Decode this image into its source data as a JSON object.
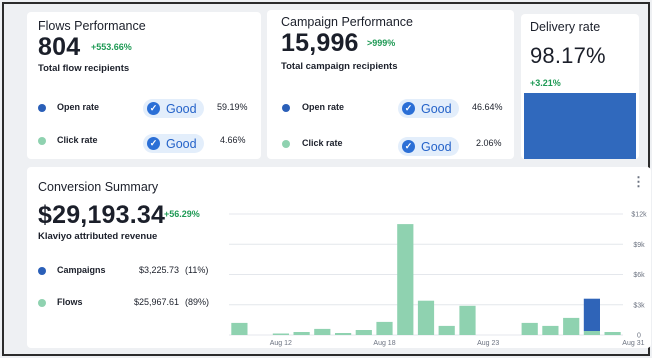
{
  "flows": {
    "title": "Flows Performance",
    "value": "804",
    "delta": "+553.66%",
    "subtitle": "Total flow recipients",
    "metrics": [
      {
        "label": "Open rate",
        "badge": "Good",
        "value": "59.19%",
        "color": "#2a5fb8"
      },
      {
        "label": "Click rate",
        "badge": "Good",
        "value": "4.66%",
        "color": "#8fd2b0"
      }
    ]
  },
  "campaign": {
    "title": "Campaign Performance",
    "value": "15,996",
    "delta": ">999%",
    "subtitle": "Total campaign recipients",
    "metrics": [
      {
        "label": "Open rate",
        "badge": "Good",
        "value": "46.64%",
        "color": "#2a5fb8"
      },
      {
        "label": "Click rate",
        "badge": "Good",
        "value": "2.06%",
        "color": "#8fd2b0"
      }
    ]
  },
  "delivery": {
    "title": "Delivery rate",
    "value": "98.17%",
    "delta": "+3.21%",
    "bar_color": "#3069bd"
  },
  "conversion": {
    "title": "Conversion Summary",
    "value": "$29,193.34",
    "delta": "+56.29%",
    "subtitle": "Klaviyo attributed revenue",
    "rows": [
      {
        "label": "Campaigns",
        "value": "$3,225.73",
        "pct": "(11%)",
        "color": "#2a5fb8"
      },
      {
        "label": "Flows",
        "value": "$25,967.61",
        "pct": "(89%)",
        "color": "#8fd2b0"
      }
    ],
    "menu_icon": "kebab-menu-icon"
  },
  "chart_data": {
    "type": "bar",
    "stacked": true,
    "x_tick_labels": [
      "Aug 12",
      "Aug 18",
      "Aug 23",
      "Aug 31"
    ],
    "x_tick_index": [
      2,
      7,
      12,
      19
    ],
    "y_tick_labels": [
      "0",
      "$3k",
      "$6k",
      "$9k",
      "$12k"
    ],
    "ylim": [
      0,
      12000
    ],
    "grid": true,
    "series": [
      {
        "name": "Flows",
        "color": "#8fd2b0",
        "values": [
          1200,
          0,
          150,
          300,
          600,
          200,
          500,
          1300,
          11000,
          3400,
          900,
          2900,
          0,
          0,
          1200,
          900,
          1700,
          400,
          300
        ]
      },
      {
        "name": "Campaigns",
        "color": "#2f64b8",
        "values": [
          0,
          0,
          0,
          0,
          0,
          0,
          0,
          0,
          0,
          0,
          0,
          0,
          0,
          0,
          0,
          0,
          0,
          3200,
          0
        ]
      }
    ]
  }
}
